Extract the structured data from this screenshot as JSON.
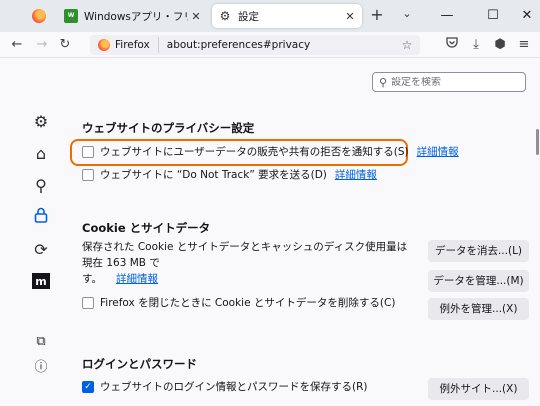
{
  "tabs": [
    {
      "title": ""
    },
    {
      "title": "Windowsアプリ・フリーソフトのおすすめ",
      "favicon": "green-app-icon"
    },
    {
      "title": "設定",
      "favicon": "gear-icon",
      "active": true
    }
  ],
  "window_controls": {
    "minimize": "—",
    "maximize": "☐",
    "close": "✕"
  },
  "navbar": {
    "identity_label": "Firefox",
    "url": "about:preferences#privacy"
  },
  "search": {
    "placeholder": "設定を検索"
  },
  "sidebar": {
    "items": [
      {
        "name": "general",
        "icon": "gear-icon"
      },
      {
        "name": "home",
        "icon": "home-icon"
      },
      {
        "name": "search",
        "icon": "search-icon"
      },
      {
        "name": "privacy",
        "icon": "lock-icon",
        "active": true
      },
      {
        "name": "sync",
        "icon": "sync-icon"
      },
      {
        "name": "more-from-mozilla",
        "icon": "mozilla-icon"
      },
      {
        "name": "extensions",
        "icon": "puzzle-icon"
      },
      {
        "name": "help",
        "icon": "help-icon"
      }
    ]
  },
  "privacy_section": {
    "heading": "ウェブサイトのプライバシー設定",
    "gpc_label": "ウェブサイトにユーザーデータの販売や共有の拒否を通知する(S)",
    "gpc_link": "詳細情報",
    "dnt_label": "ウェブサイトに “Do Not Track” 要求を送る(D)",
    "dnt_link": "詳細情報"
  },
  "cookie_section": {
    "heading": "Cookie とサイトデータ",
    "description_line1": "保存された Cookie とサイトデータとキャッシュのディスク使用量は現在 163 MB で",
    "description_line2": "す。",
    "learn_more": "詳細情報",
    "clear_button": "データを消去...(L)",
    "manage_button": "データを管理...(M)",
    "exceptions_button": "例外を管理...(X)",
    "delete_on_close_label": "Firefox を閉じたときに Cookie とサイトデータを削除する(C)"
  },
  "login_section": {
    "heading": "ログインとパスワード",
    "save_logins_label": "ウェブサイトのログイン情報とパスワードを保存する(R)",
    "exceptions_button": "例外サイト...(X)"
  },
  "colors": {
    "accent": "#0061e0",
    "highlight": "#ef6c00"
  }
}
